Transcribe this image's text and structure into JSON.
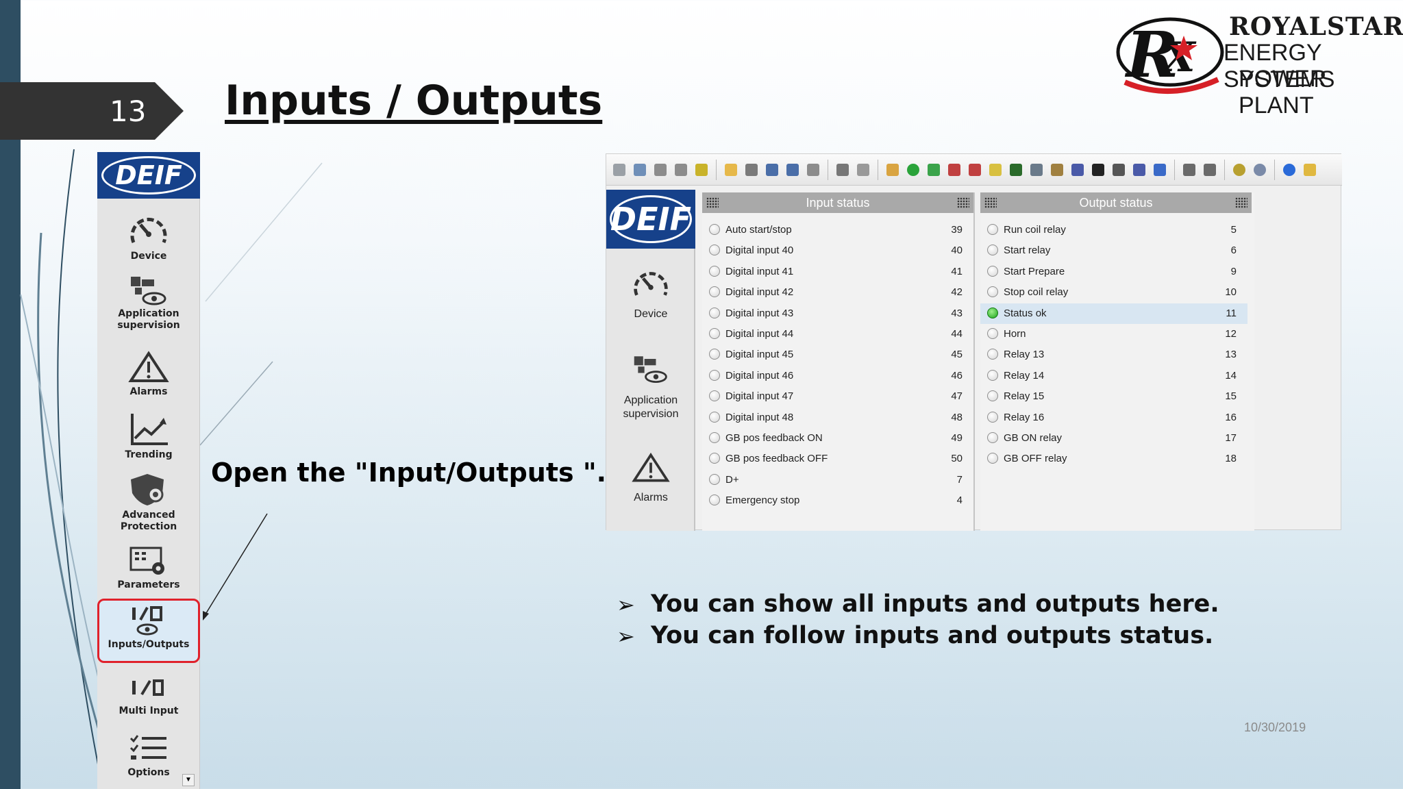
{
  "slide": {
    "number": "13",
    "title": "Inputs / Outputs",
    "date": "10/30/2019"
  },
  "logo": {
    "line1": "ROYALSTAR",
    "line2": "ENERGY SYSTEMS",
    "line3": "POWER PLANT",
    "colors": {
      "red": "#d62027",
      "black": "#111111"
    }
  },
  "sidebar": {
    "brand": "DEIF",
    "items": [
      {
        "label": "Device",
        "icon": "gauge-icon"
      },
      {
        "label": "Application supervision",
        "icon": "supervision-eye-icon"
      },
      {
        "label": "Alarms",
        "icon": "warning-triangle-icon"
      },
      {
        "label": "Trending",
        "icon": "trend-chart-icon"
      },
      {
        "label": "Advanced Protection",
        "icon": "shield-gear-icon"
      },
      {
        "label": "Parameters",
        "icon": "parameters-gear-icon"
      },
      {
        "label": "Inputs/Outputs",
        "icon": "io-eye-icon",
        "active": true
      },
      {
        "label": "Multi Input",
        "icon": "io-icon"
      },
      {
        "label": "Options",
        "icon": "checklist-icon"
      }
    ]
  },
  "instruction": "Open the \"Input/Outputs \".",
  "app": {
    "brand": "DEIF",
    "sidebar": [
      {
        "label": "Device",
        "icon": "gauge-icon"
      },
      {
        "label": "Application supervision",
        "icon": "supervision-eye-icon"
      },
      {
        "label": "Alarms",
        "icon": "warning-triangle-icon"
      }
    ],
    "input_panel": {
      "title": "Input status",
      "rows": [
        {
          "name": "Auto start/stop",
          "num": "39"
        },
        {
          "name": "Digital input 40",
          "num": "40"
        },
        {
          "name": "Digital input 41",
          "num": "41"
        },
        {
          "name": "Digital input 42",
          "num": "42"
        },
        {
          "name": "Digital input 43",
          "num": "43"
        },
        {
          "name": "Digital input 44",
          "num": "44"
        },
        {
          "name": "Digital input 45",
          "num": "45"
        },
        {
          "name": "Digital input 46",
          "num": "46"
        },
        {
          "name": "Digital input 47",
          "num": "47"
        },
        {
          "name": "Digital input 48",
          "num": "48"
        },
        {
          "name": "GB pos feedback ON",
          "num": "49"
        },
        {
          "name": "GB pos feedback OFF",
          "num": "50"
        },
        {
          "name": "D+",
          "num": "7"
        },
        {
          "name": "Emergency stop",
          "num": "4"
        }
      ]
    },
    "output_panel": {
      "title": "Output status",
      "rows": [
        {
          "name": "Run coil relay",
          "num": "5"
        },
        {
          "name": "Start relay",
          "num": "6"
        },
        {
          "name": "Start Prepare",
          "num": "9"
        },
        {
          "name": "Stop coil relay",
          "num": "10"
        },
        {
          "name": "Status ok",
          "num": "11",
          "on": true
        },
        {
          "name": "Horn",
          "num": "12"
        },
        {
          "name": "Relay 13",
          "num": "13"
        },
        {
          "name": "Relay 14",
          "num": "14"
        },
        {
          "name": "Relay 15",
          "num": "15"
        },
        {
          "name": "Relay 16",
          "num": "16"
        },
        {
          "name": "GB ON relay",
          "num": "17"
        },
        {
          "name": "GB OFF relay",
          "num": "18"
        }
      ]
    },
    "toolbar_icons": [
      "link-icon",
      "settings-icon",
      "users-icon",
      "users-icon",
      "key-icon",
      "open-folder-icon",
      "new-doc-icon",
      "save-icon",
      "save-as-icon",
      "folder-icon",
      "print-icon",
      "print-preview-icon",
      "edit-icon",
      "green-n-icon",
      "refresh-icon",
      "write-icon",
      "write-all-icon",
      "wizard-icon",
      "monitor-icon",
      "network-icon",
      "tools-icon",
      "pid-icon",
      "clock-icon",
      "sum-icon",
      "id-icon",
      "transfer-icon",
      "list-icon",
      "sort-icon",
      "gear-icon",
      "male-icon",
      "info-icon",
      "shield-icon"
    ],
    "colors": {
      "header": "#a9a9a9",
      "highlight": "#d8e6f2",
      "status_on": "#1aa31a"
    }
  },
  "bullets": [
    "You can show all inputs and outputs here.",
    "You can follow inputs and outputs status."
  ]
}
